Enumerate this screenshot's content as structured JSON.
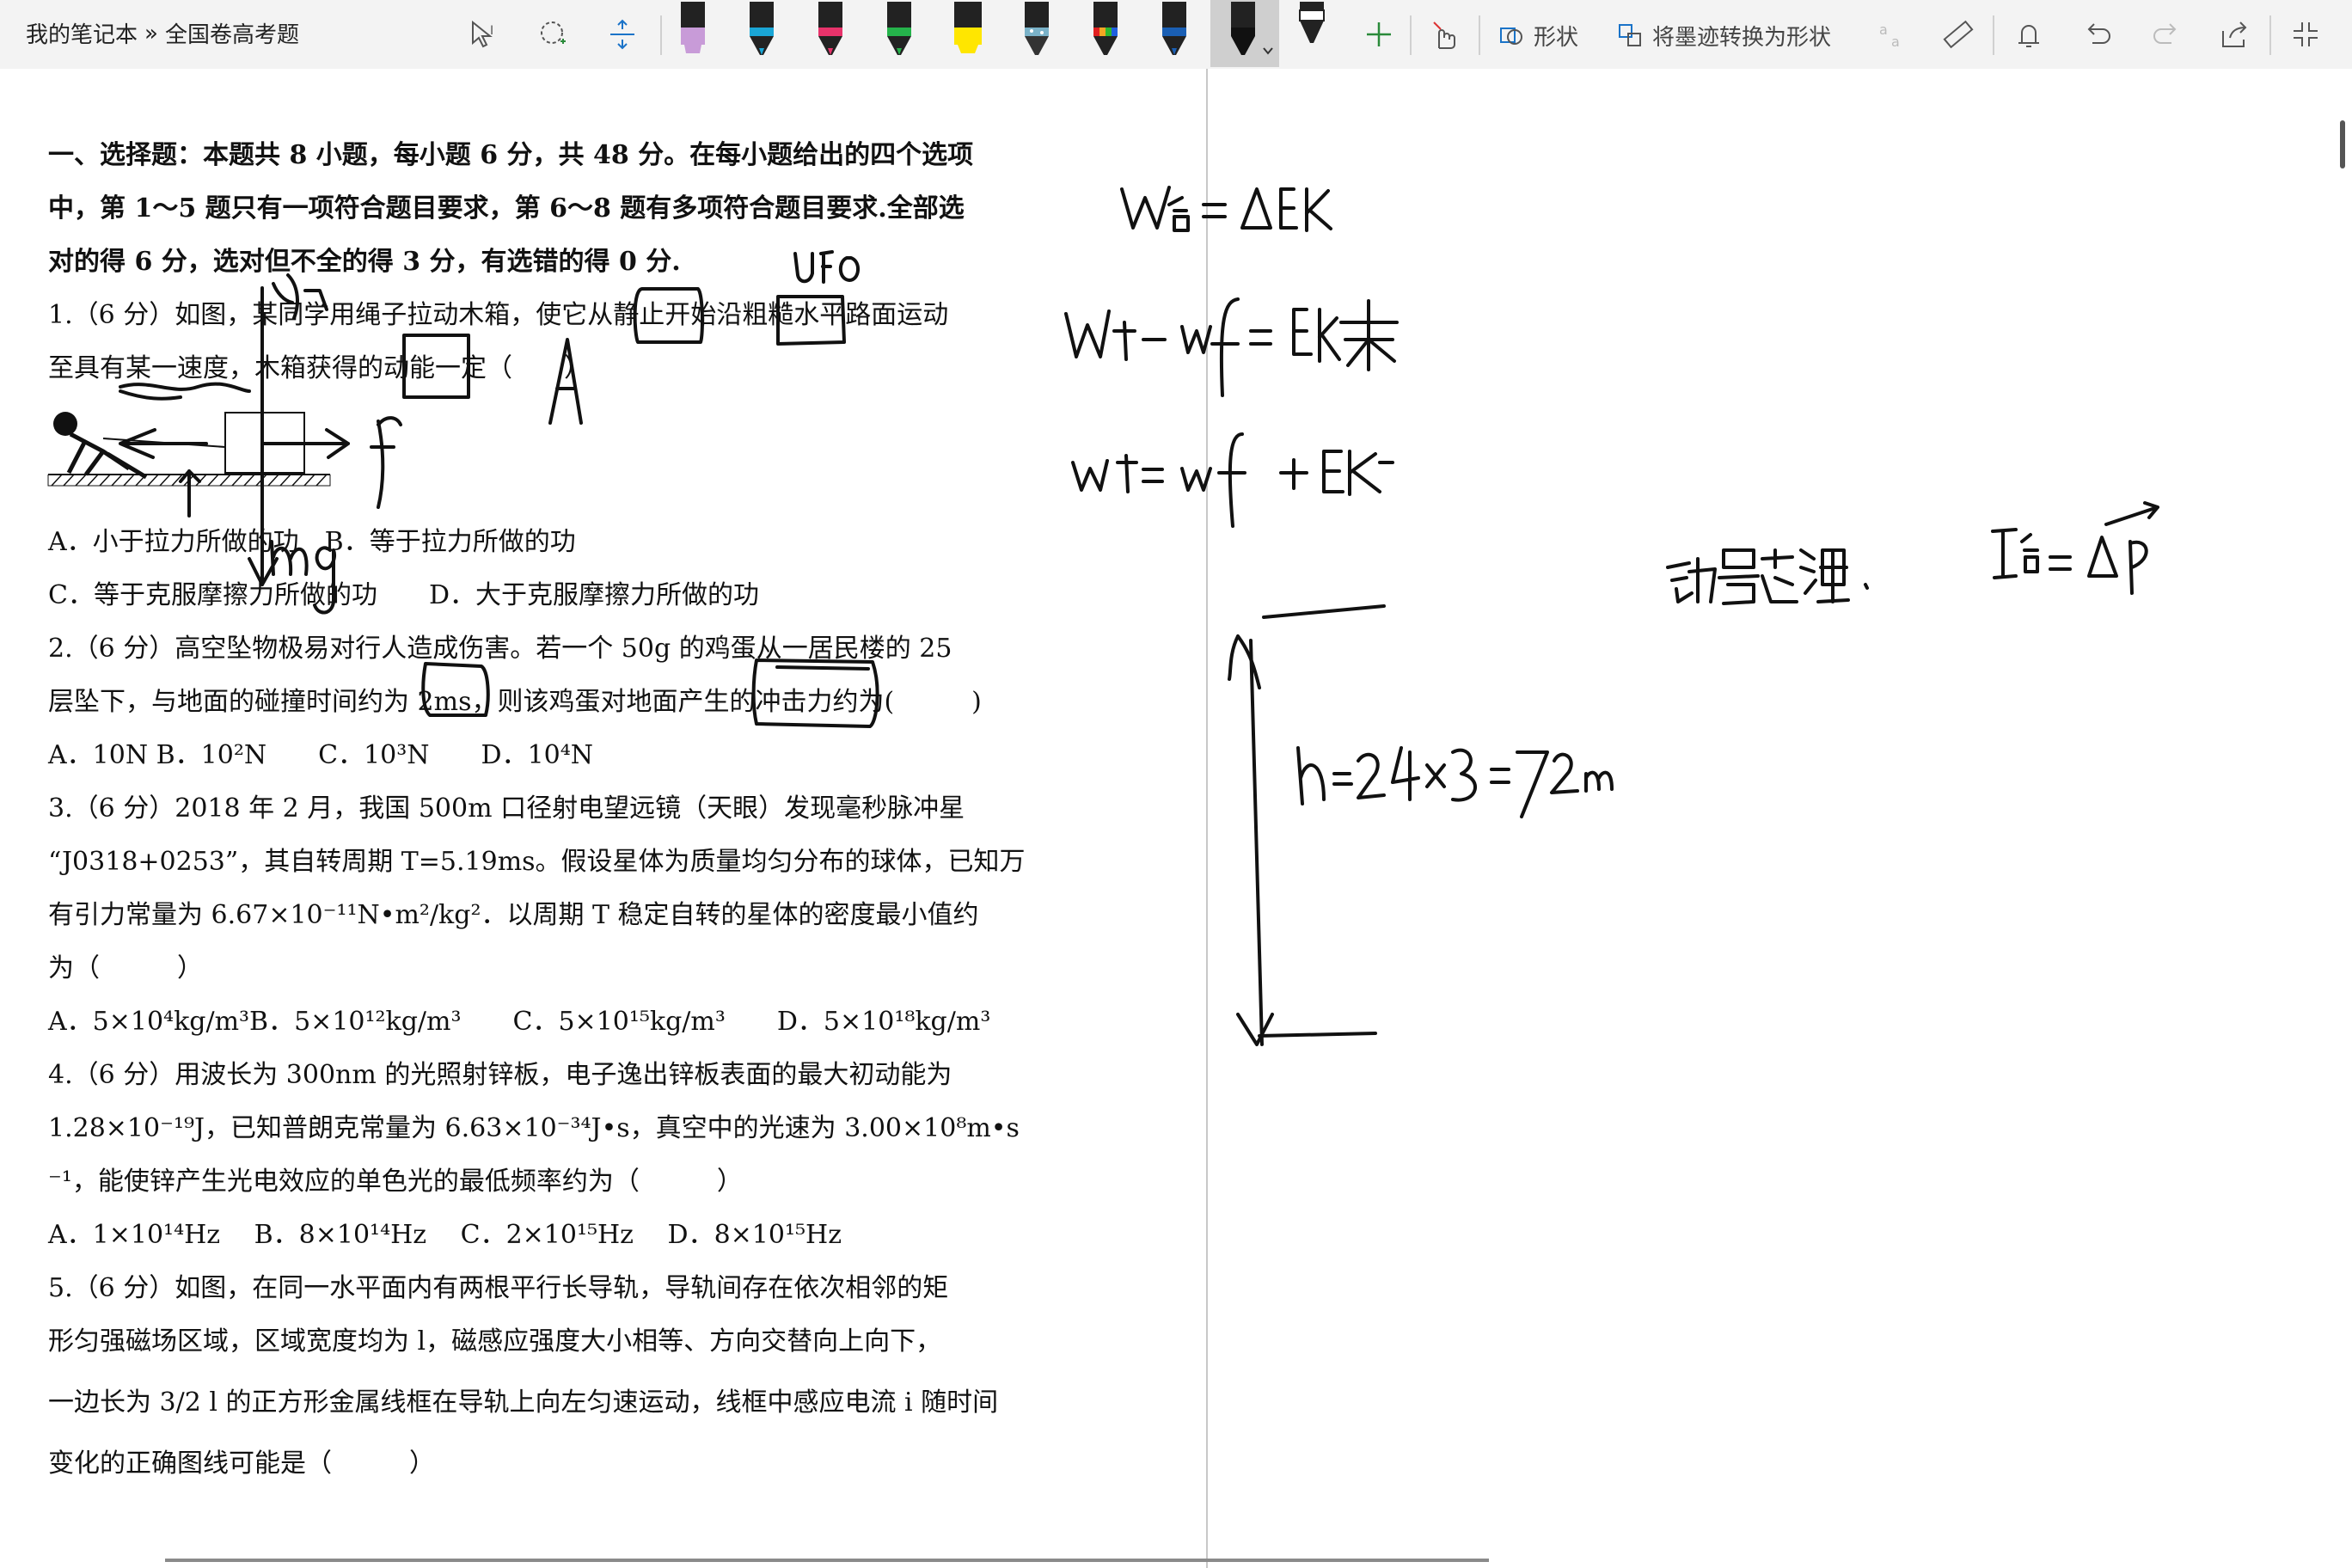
{
  "breadcrumb": {
    "notebook": "我的笔记本",
    "separator": "»",
    "section": "全国卷高考题"
  },
  "toolbar": {
    "shapes_label": "形状",
    "convert_label": "将墨迹转换为形状",
    "pens": [
      {
        "name": "purple-highlighter",
        "color": "#c89bd8"
      },
      {
        "name": "cyan-pen",
        "color": "#1aa6d6"
      },
      {
        "name": "pink-pen",
        "color": "#e8336b"
      },
      {
        "name": "green-pen",
        "color": "#25b34b"
      },
      {
        "name": "yellow-highlighter",
        "color": "#ffe600"
      },
      {
        "name": "galaxy-pen",
        "color": "#7ab2c8"
      },
      {
        "name": "rainbow-pen",
        "color": "#e06a2c"
      },
      {
        "name": "blue-pen",
        "color": "#1a5fb4"
      },
      {
        "name": "black-pen-active",
        "color": "#111111"
      },
      {
        "name": "black-sketch-pen",
        "color": "#222222"
      }
    ]
  },
  "doc": {
    "intro": [
      "一、选择题：本题共 8 小题，每小题 6 分，共 48 分。在每小题给出的四个选项",
      "中，第 1～5 题只有一项符合题目要求，第 6～8 题有多项符合题目要求.全部选",
      "对的得 6 分，选对但不全的得 3 分，有选错的得 0 分."
    ],
    "q1": [
      "1.（6 分）如图，某同学用绳子拉动木箱，使它从静止开始沿粗糙水平路面运动",
      "至具有某一速度，木箱获得的动能一定（　　）"
    ],
    "q1_options": [
      "A．小于拉力所做的功　B．等于拉力所做的功",
      "C．等于克服摩擦力所做的功　　D．大于克服摩擦力所做的功"
    ],
    "q2": [
      "2.（6 分）高空坠物极易对行人造成伤害。若一个 50g 的鸡蛋从一居民楼的 25",
      "层坠下，与地面的碰撞时间约为 2ms，则该鸡蛋对地面产生的冲击力约为(　　　)"
    ],
    "q2_options": "A．10N B．10²N　　C．10³N　　D．10⁴N",
    "q3": [
      "3.（6 分）2018 年 2 月，我国 500m 口径射电望远镜（天眼）发现毫秒脉冲星",
      "“J0318+0253”，其自转周期 T=5.19ms。假设星体为质量均匀分布的球体，已知万",
      "有引力常量为 6.67×10⁻¹¹N•m²/kg²．以周期 T 稳定自转的星体的密度最小值约",
      "为（　　　）"
    ],
    "q3_options": "A．5×10⁴kg/m³B．5×10¹²kg/m³　　C．5×10¹⁵kg/m³　　D．5×10¹⁸kg/m³",
    "q4": [
      "4.（6 分）用波长为 300nm 的光照射锌板，电子逸出锌板表面的最大初动能为",
      "1.28×10⁻¹⁹J，已知普朗克常量为 6.63×10⁻³⁴J•s，真空中的光速为 3.00×10⁸m•s",
      "⁻¹，能使锌产生光电效应的单色光的最低频率约为（　　　）"
    ],
    "q4_options": "A．1×10¹⁴Hz　 B．8×10¹⁴Hz　 C．2×10¹⁵Hz　 D．8×10¹⁵Hz",
    "q5": [
      "5.（6 分）如图，在同一水平面内有两根平行长导轨，导轨间存在依次相邻的矩",
      "形匀强磁场区域，区域宽度均为 l，磁感应强度大小相等、方向交替向上向下，",
      "一边长为 3/2 l 的正方形金属线框在导轨上向左匀速运动，线框中感应电流 i 随时间",
      "变化的正确图线可能是（　　　）"
    ]
  }
}
